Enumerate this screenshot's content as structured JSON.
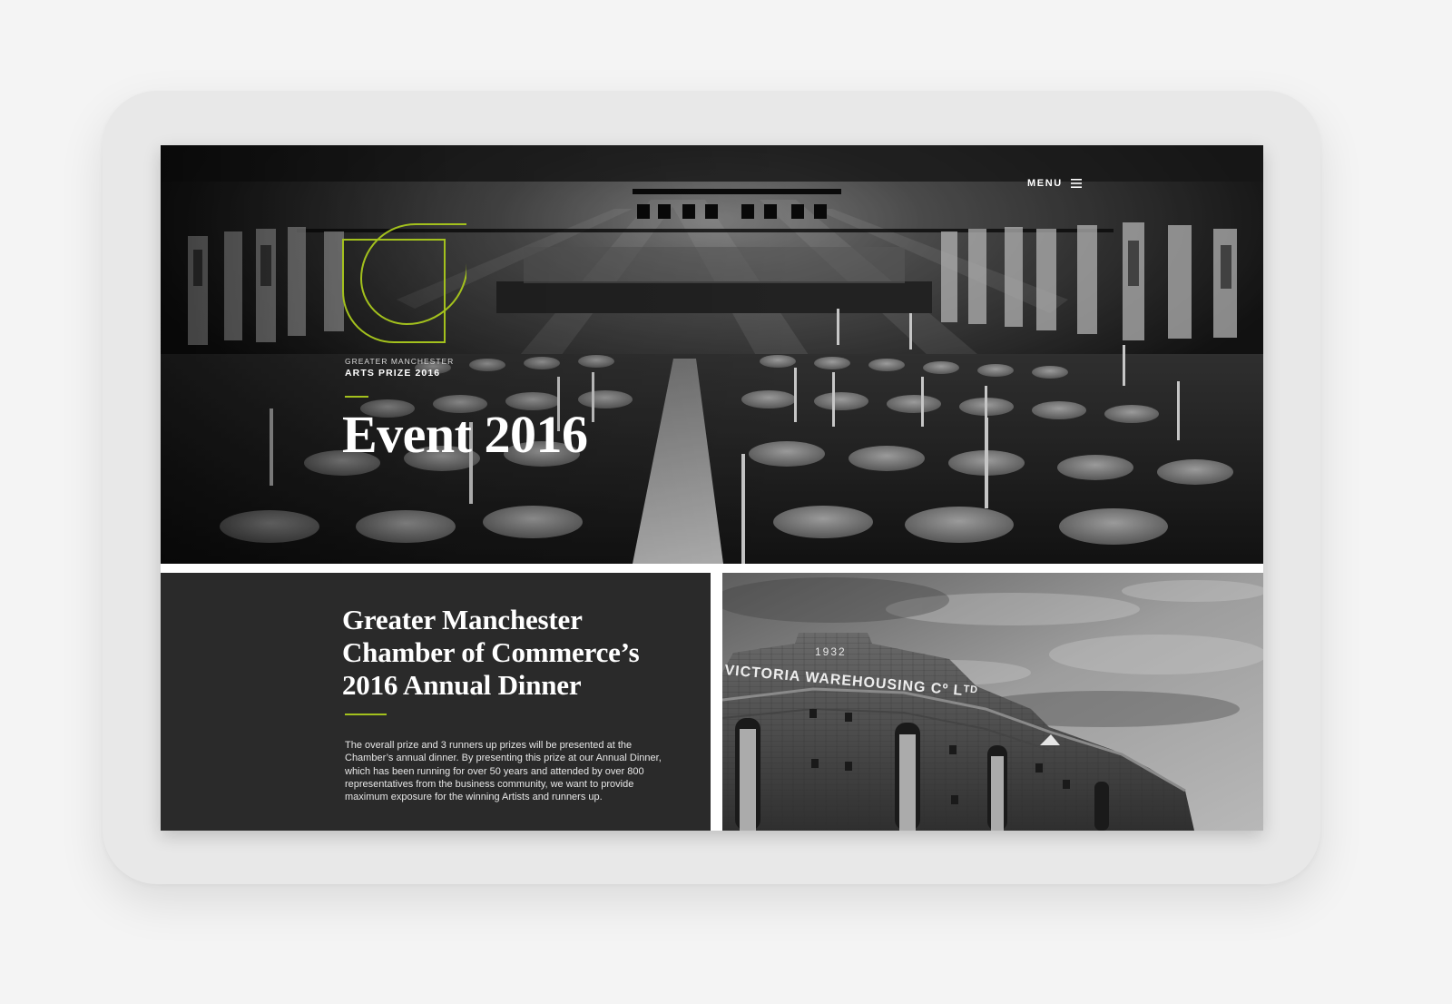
{
  "header": {
    "menu_label": "MENU"
  },
  "logo": {
    "line1": "GREATER MANCHESTER",
    "line2": "ARTS PRIZE 2016"
  },
  "hero": {
    "title": "Event 2016"
  },
  "info": {
    "title_lines": [
      "Greater Manchester",
      "Chamber of Commerce’s",
      "2016 Annual Dinner"
    ],
    "body": "The overall prize and 3 runners up prizes will be presented at the Chamber’s annual dinner. By presenting this prize at our Annual Dinner, which has been running for over 50 years and attended by over 800 representatives from the business community, we want to provide maximum exposure for the winning Artists and runners up."
  },
  "warehouse_photo": {
    "year": "1932",
    "sign": "VICTORIA WAREHOUSING Cº Lᵀᴰ"
  },
  "colors": {
    "accent": "#a3c11d",
    "panel": "#2a2a2a",
    "page_background": "#f4f4f4",
    "device_frame": "#e8e8e8"
  },
  "icons": {
    "menu": "hamburger-icon",
    "logo": "leaf-logo-icon"
  }
}
